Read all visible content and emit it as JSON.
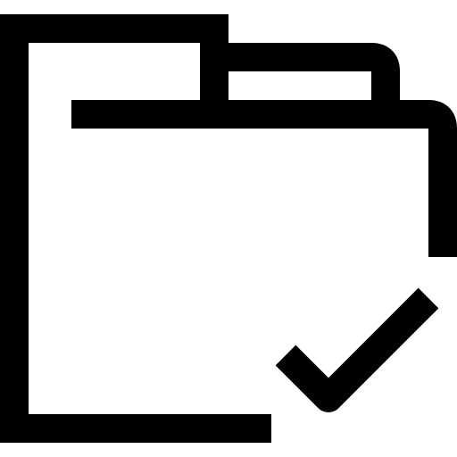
{
  "icon": {
    "name": "folder-check-icon",
    "stroke_color": "#000000",
    "background_color": "#ffffff"
  }
}
